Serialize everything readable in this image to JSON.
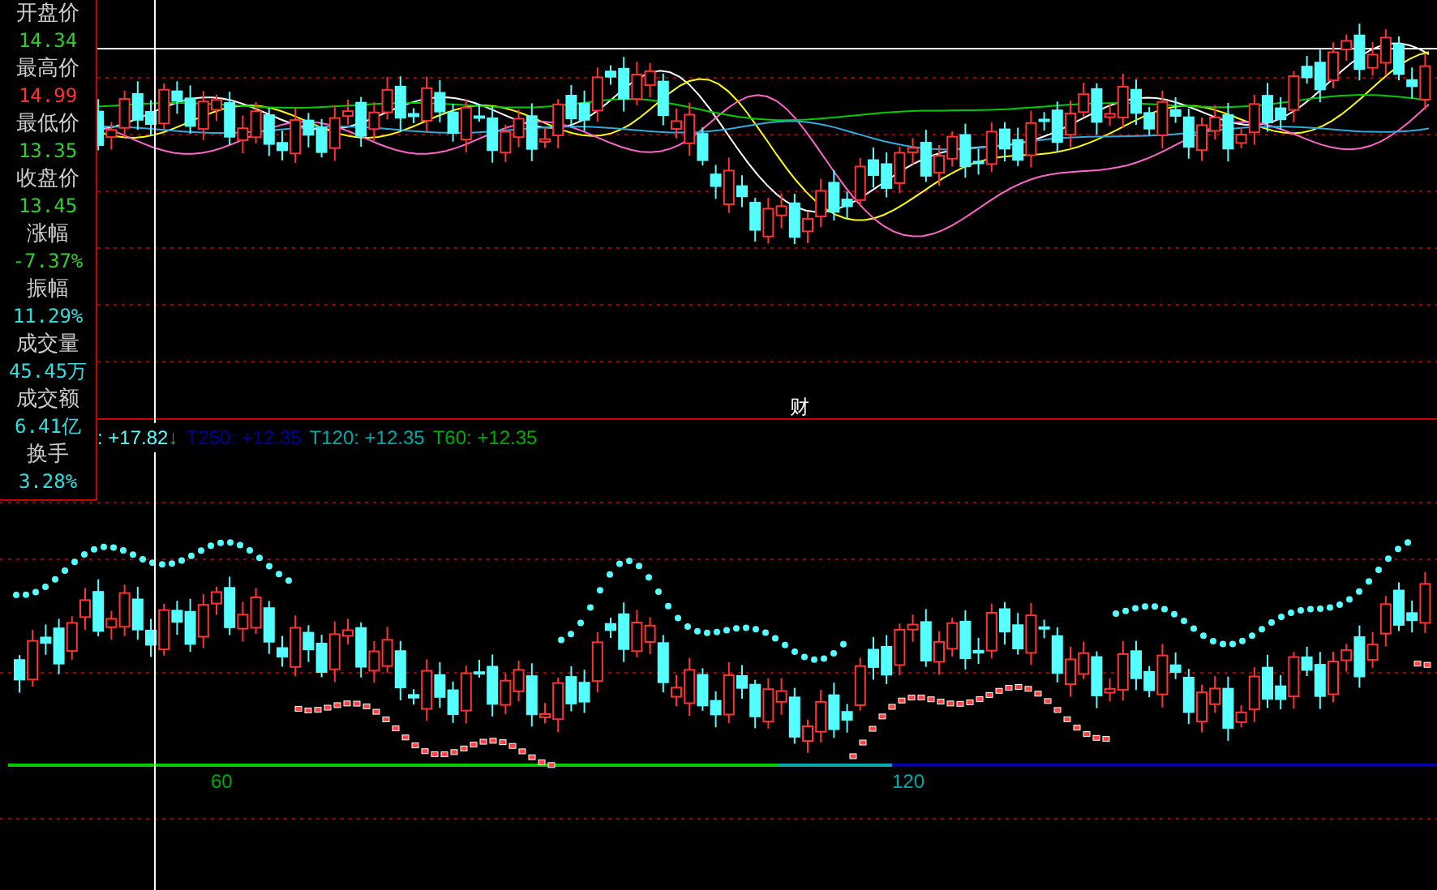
{
  "info_panel": [
    {
      "label": "开盘价",
      "value": "14.34",
      "color": "#33cc33"
    },
    {
      "label": "最高价",
      "value": "14.99",
      "color": "#ff3333"
    },
    {
      "label": "最低价",
      "value": "13.35",
      "color": "#33cc33"
    },
    {
      "label": "收盘价",
      "value": "13.45",
      "color": "#33cc33"
    },
    {
      "label": "涨幅",
      "value": "-7.37%",
      "color": "#33cc33"
    },
    {
      "label": "振幅",
      "value": "11.29%",
      "color": "#33dddd"
    },
    {
      "label": "成交量",
      "value": "45.45万",
      "color": "#33dddd"
    },
    {
      "label": "成交额",
      "value": "6.41亿",
      "color": "#33dddd"
    },
    {
      "label": "换手",
      "value": "3.28%",
      "color": "#33dddd"
    }
  ],
  "event_marker": "财",
  "indicator_legend": [
    {
      "text": ": +17.82",
      "arrow": "↓",
      "color": "#55ffff"
    },
    {
      "text": "T250: +12.35",
      "color": "#000099"
    },
    {
      "text": "T120: +12.35",
      "color": "#00aaaa"
    },
    {
      "text": "T60: +12.35",
      "color": "#00aa00"
    }
  ],
  "baseline_labels": [
    {
      "text": "60",
      "color": "#00aa00"
    },
    {
      "text": "120",
      "color": "#00aaaa"
    }
  ]
}
